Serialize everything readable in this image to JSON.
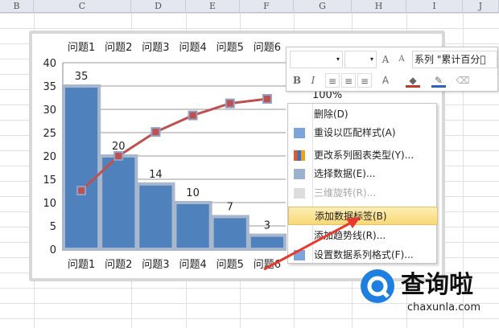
{
  "columns": [
    "B",
    "C",
    "D",
    "E",
    "F",
    "G",
    "H",
    "I",
    "J"
  ],
  "chart": {
    "categories": [
      "问题1",
      "问题2",
      "问题3",
      "问题4",
      "问题5",
      "问题6"
    ],
    "y_ticks": [
      "0",
      "5",
      "10",
      "15",
      "20",
      "25",
      "30",
      "35",
      "40"
    ],
    "secondary_tick_visible": "100%",
    "chart_data": {
      "type": "bar",
      "categories": [
        "问题1",
        "问题2",
        "问题3",
        "问题4",
        "问题5",
        "问题6"
      ],
      "series": [
        {
          "type": "bar",
          "values": [
            35,
            20,
            14,
            10,
            7,
            3
          ],
          "color": "#4f81bd"
        },
        {
          "name": "累计百分比",
          "type": "line",
          "values": [
            0.39,
            0.62,
            0.78,
            0.89,
            0.97,
            1.0
          ],
          "color": "#c0504d"
        }
      ],
      "ylim": [
        0,
        40
      ],
      "y2lim": [
        0,
        1
      ],
      "data_labels": [
        "35",
        "20",
        "14",
        "10",
        "7",
        "3"
      ],
      "grid": true
    }
  },
  "mini_toolbar": {
    "series_select": "系列 \"累计百分\u0000",
    "bold": "B",
    "italic": "I",
    "grow": "A",
    "shrink": "A"
  },
  "context_menu": {
    "items": [
      {
        "label": "删除(D)",
        "icon": "none",
        "disabled": false
      },
      {
        "label": "重设以匹配样式(A)",
        "icon": "reset-style-icon",
        "disabled": false
      },
      {
        "label": "更改系列图表类型(Y)...",
        "icon": "chart-type-icon",
        "disabled": false
      },
      {
        "label": "选择数据(E)...",
        "icon": "select-data-icon",
        "disabled": false
      },
      {
        "label": "三维旋转(R)...",
        "icon": "3d-rotate-icon",
        "disabled": true
      },
      {
        "label": "添加数据标签(B)",
        "icon": "none",
        "disabled": false,
        "highlighted": true
      },
      {
        "label": "添加趋势线(R)...",
        "icon": "none",
        "disabled": false
      },
      {
        "label": "设置数据系列格式(F)...",
        "icon": "format-icon",
        "disabled": false
      }
    ]
  },
  "watermark": {
    "name": "查询啦",
    "url": "chaxunla.com"
  }
}
